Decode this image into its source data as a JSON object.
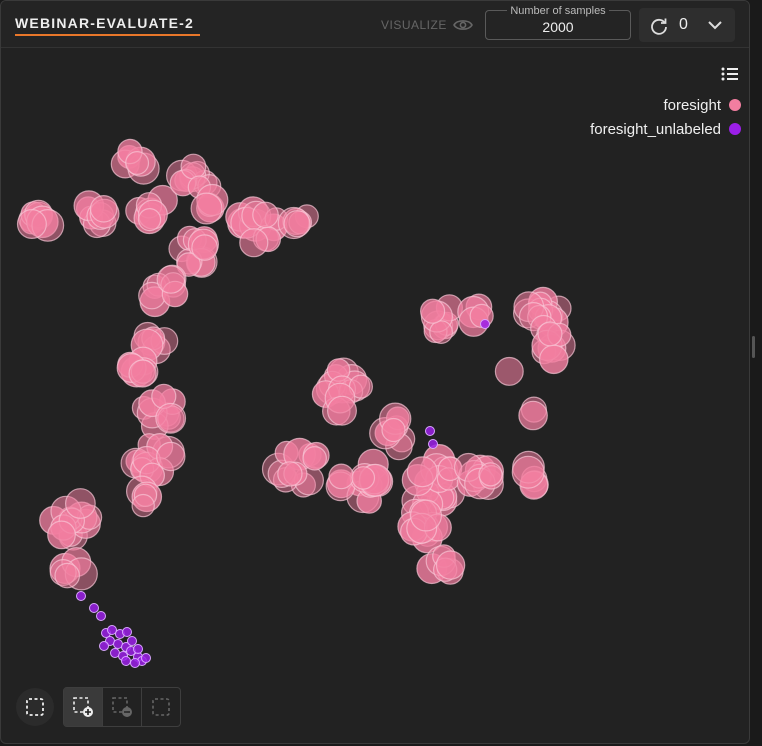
{
  "header": {
    "title": "WEBINAR-EVALUATE-2",
    "visualize_label": "VISUALIZE",
    "samples_label": "Number of samples",
    "samples_value": "2000",
    "refresh_count": "0"
  },
  "colors": {
    "accent": "#e9772a",
    "foresight": "#f27ea0",
    "foresight_unlabeled": "#9b1fe8"
  },
  "legend": {
    "items": [
      {
        "label": "foresight",
        "color": "#f27ea0"
      },
      {
        "label": "foresight_unlabeled",
        "color": "#9b1fe8"
      }
    ]
  },
  "chart_data": {
    "type": "scatter",
    "title": "",
    "xlabel": "",
    "ylabel": "",
    "grid": false,
    "legend_placement": "top-right",
    "series": [
      {
        "name": "foresight",
        "color": "#f27ea0",
        "clusters": [
          {
            "x": 40,
            "y": 218,
            "spread": 14,
            "n": 8
          },
          {
            "x": 95,
            "y": 210,
            "spread": 14,
            "n": 8
          },
          {
            "x": 150,
            "y": 205,
            "spread": 14,
            "n": 7
          },
          {
            "x": 135,
            "y": 160,
            "spread": 12,
            "n": 6
          },
          {
            "x": 195,
            "y": 178,
            "spread": 16,
            "n": 10
          },
          {
            "x": 215,
            "y": 205,
            "spread": 10,
            "n": 4
          },
          {
            "x": 260,
            "y": 222,
            "spread": 22,
            "n": 12
          },
          {
            "x": 300,
            "y": 220,
            "spread": 10,
            "n": 5
          },
          {
            "x": 190,
            "y": 250,
            "spread": 18,
            "n": 10
          },
          {
            "x": 165,
            "y": 290,
            "spread": 16,
            "n": 8
          },
          {
            "x": 155,
            "y": 340,
            "spread": 12,
            "n": 6
          },
          {
            "x": 135,
            "y": 370,
            "spread": 14,
            "n": 7
          },
          {
            "x": 160,
            "y": 410,
            "spread": 18,
            "n": 10
          },
          {
            "x": 150,
            "y": 455,
            "spread": 20,
            "n": 12
          },
          {
            "x": 145,
            "y": 495,
            "spread": 10,
            "n": 4
          },
          {
            "x": 70,
            "y": 520,
            "spread": 20,
            "n": 12
          },
          {
            "x": 70,
            "y": 570,
            "spread": 12,
            "n": 5
          },
          {
            "x": 440,
            "y": 320,
            "spread": 16,
            "n": 8
          },
          {
            "x": 480,
            "y": 315,
            "spread": 10,
            "n": 4
          },
          {
            "x": 540,
            "y": 310,
            "spread": 18,
            "n": 12
          },
          {
            "x": 555,
            "y": 345,
            "spread": 14,
            "n": 8
          },
          {
            "x": 506,
            "y": 370,
            "spread": 4,
            "n": 1
          },
          {
            "x": 530,
            "y": 412,
            "spread": 6,
            "n": 2
          },
          {
            "x": 340,
            "y": 392,
            "spread": 24,
            "n": 14
          },
          {
            "x": 400,
            "y": 430,
            "spread": 16,
            "n": 8
          },
          {
            "x": 300,
            "y": 470,
            "spread": 24,
            "n": 12
          },
          {
            "x": 360,
            "y": 480,
            "spread": 22,
            "n": 14
          },
          {
            "x": 430,
            "y": 480,
            "spread": 26,
            "n": 18
          },
          {
            "x": 480,
            "y": 475,
            "spread": 18,
            "n": 10
          },
          {
            "x": 530,
            "y": 475,
            "spread": 10,
            "n": 5
          },
          {
            "x": 420,
            "y": 530,
            "spread": 22,
            "n": 12
          },
          {
            "x": 440,
            "y": 565,
            "spread": 12,
            "n": 6
          }
        ]
      },
      {
        "name": "foresight_unlabeled",
        "color": "#9b1fe8",
        "points": [
          [
            80,
            595
          ],
          [
            93,
            607
          ],
          [
            100,
            615
          ],
          [
            105,
            632
          ],
          [
            111,
            629
          ],
          [
            119,
            633
          ],
          [
            126,
            631
          ],
          [
            109,
            640
          ],
          [
            117,
            643
          ],
          [
            125,
            646
          ],
          [
            131,
            640
          ],
          [
            103,
            645
          ],
          [
            114,
            652
          ],
          [
            122,
            655
          ],
          [
            130,
            650
          ],
          [
            137,
            656
          ],
          [
            141,
            660
          ],
          [
            134,
            662
          ],
          [
            125,
            660
          ],
          [
            145,
            657
          ],
          [
            137,
            648
          ],
          [
            484,
            323
          ],
          [
            429,
            430
          ],
          [
            432,
            443
          ]
        ]
      }
    ]
  }
}
